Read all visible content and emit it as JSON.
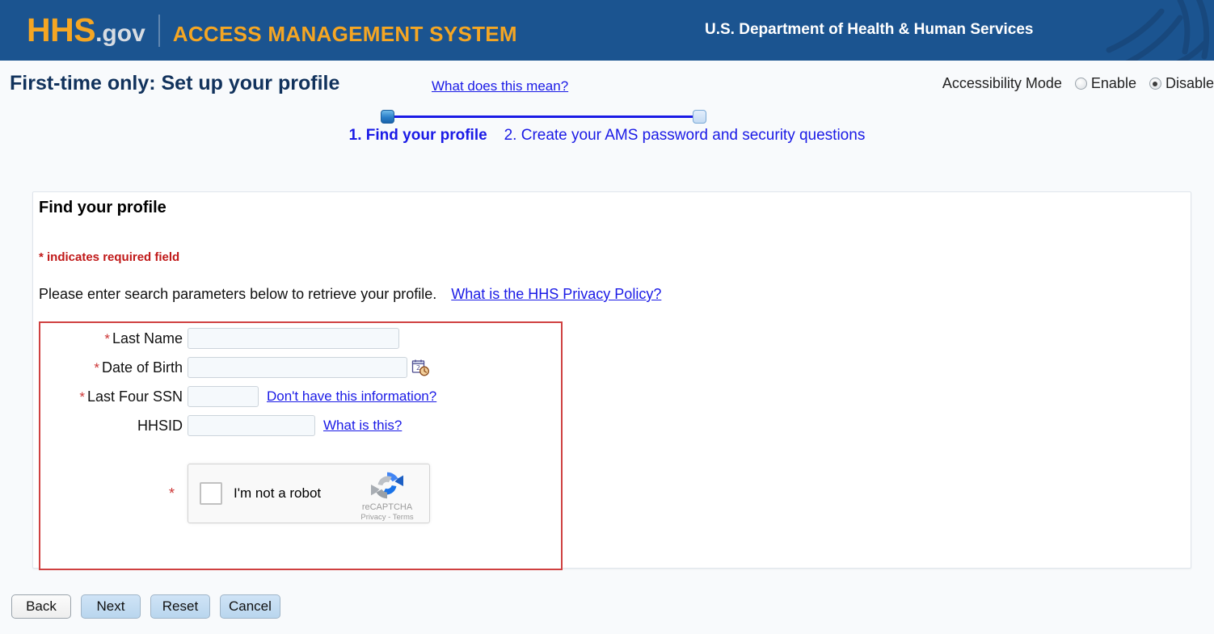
{
  "banner": {
    "logo_hhs": "HHS",
    "logo_gov": ".gov",
    "logo_system": "ACCESS MANAGEMENT SYSTEM",
    "department": "U.S. Department of Health & Human Services",
    "background_color": "#1b5490",
    "logo_color": "#f5a623"
  },
  "title": {
    "heading": "First-time only: Set up your profile",
    "help_link": "What does this mean?"
  },
  "accessibility": {
    "label": "Accessibility Mode",
    "enable_label": "Enable",
    "disable_label": "Disable",
    "selected": "Disable"
  },
  "steps": {
    "step1_label": "1. Find your profile",
    "step2_label": "2. Create your AMS password and security questions",
    "current": 1
  },
  "panel": {
    "heading": "Find your profile",
    "required_note": "* indicates required field",
    "instructions": "Please enter search parameters below to retrieve your profile.",
    "privacy_link": "What is the HHS Privacy Policy?"
  },
  "form": {
    "border_color": "#cf4040",
    "fields": [
      {
        "label": "Last Name",
        "required": true,
        "value": "",
        "help": ""
      },
      {
        "label": "Date of Birth",
        "required": true,
        "value": "",
        "help": ""
      },
      {
        "label": "Last Four SSN",
        "required": true,
        "value": "",
        "help": "Don't have this information?"
      },
      {
        "label": "HHSID",
        "required": false,
        "value": "",
        "help": "What is this?"
      }
    ],
    "required_marker": "*"
  },
  "captcha": {
    "required_marker": "*",
    "checkbox_label": "I'm not a robot",
    "brand": "reCAPTCHA",
    "legal": "Privacy - Terms",
    "checked": false
  },
  "buttons": [
    {
      "label": "Back",
      "style": "secondary"
    },
    {
      "label": "Next",
      "style": "primary"
    },
    {
      "label": "Reset",
      "style": "primary"
    },
    {
      "label": "Cancel",
      "style": "primary"
    }
  ]
}
